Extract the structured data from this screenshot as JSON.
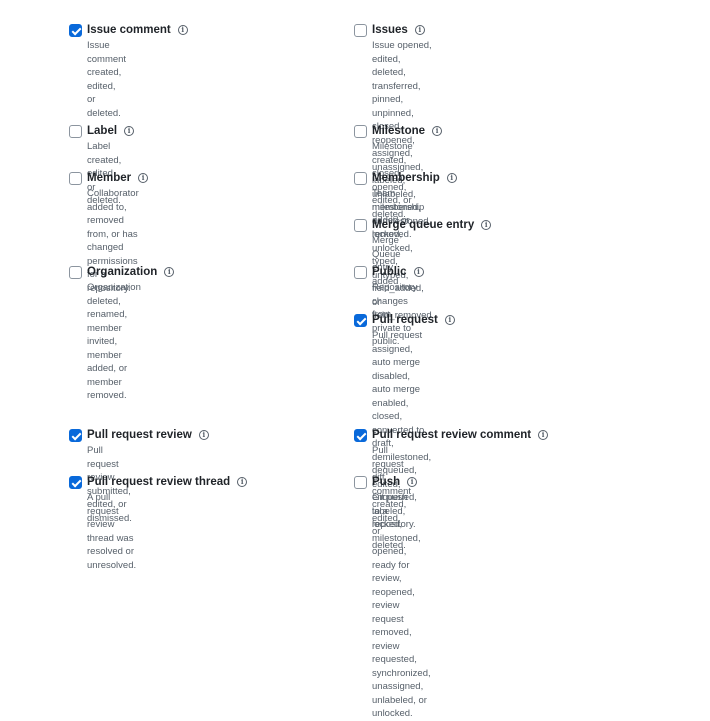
{
  "events": [
    {
      "id": "issue-comment",
      "title": "Issue comment",
      "checked": true,
      "lines": [
        "Issue comment created, edited, or deleted."
      ]
    },
    {
      "id": "issues",
      "title": "Issues",
      "checked": false,
      "lines": [
        "Issue opened, edited, deleted, transferred, pinned,",
        "unpinned, closed, reopened, assigned, unassigned,",
        "labeled, unlabeled, milestoned, demilestoned, locked,",
        "unlocked, typed, untyped, field_added, or",
        "field_removed."
      ]
    },
    {
      "id": "label",
      "title": "Label",
      "checked": false,
      "lines": [
        "Label created, edited or deleted."
      ]
    },
    {
      "id": "milestone",
      "title": "Milestone",
      "checked": false,
      "lines": [
        "Milestone created, closed, opened, edited, or deleted."
      ]
    },
    {
      "id": "member",
      "title": "Member",
      "checked": false,
      "lines": [
        "Collaborator added to, removed from, or has changed",
        "permissions for a repository."
      ]
    },
    {
      "id": "membership",
      "title": "Membership",
      "checked": false,
      "lines": [
        "Team membership added or removed."
      ]
    },
    {
      "id": "merge-queue-entry",
      "title": "Merge queue entry",
      "checked": false,
      "lines": [
        "Merge Queue entry added"
      ]
    },
    {
      "id": "organization",
      "title": "Organization",
      "checked": false,
      "lines": [
        "Organization deleted, renamed, member invited, member",
        "added, or member removed."
      ]
    },
    {
      "id": "public",
      "title": "Public",
      "checked": false,
      "lines": [
        "Repository changes from private to public."
      ]
    },
    {
      "id": "pull-request",
      "title": "Pull request",
      "checked": true,
      "lines": [
        "Pull request assigned, auto merge disabled, auto merge",
        "enabled, closed, converted to draft, demilestoned,",
        "dequeued, edited, enqueued, labeled, locked,",
        "milestoned, opened, ready for review, reopened, review",
        "request removed, review requested, synchronized,",
        "unassigned, unlabeled, or unlocked."
      ]
    },
    {
      "id": "pull-request-review",
      "title": "Pull request review",
      "checked": true,
      "lines": [
        "Pull request review submitted, edited, or dismissed."
      ]
    },
    {
      "id": "pull-request-review-comment",
      "title": "Pull request review comment",
      "checked": true,
      "lines": [
        "Pull request diff comment created, edited, or deleted."
      ]
    },
    {
      "id": "pull-request-review-thread",
      "title": "Pull request review thread",
      "checked": true,
      "lines": [
        "A pull request review thread was resolved or unresolved."
      ]
    },
    {
      "id": "push",
      "title": "Push",
      "checked": false,
      "lines": [
        "Git push to a repository."
      ]
    }
  ],
  "colors": {
    "checkbox_checked": "#0969da",
    "title_text": "#1f2328",
    "description_text": "#57606a"
  },
  "icons": {
    "info": "info-circle-icon",
    "check": "checkmark-icon"
  }
}
